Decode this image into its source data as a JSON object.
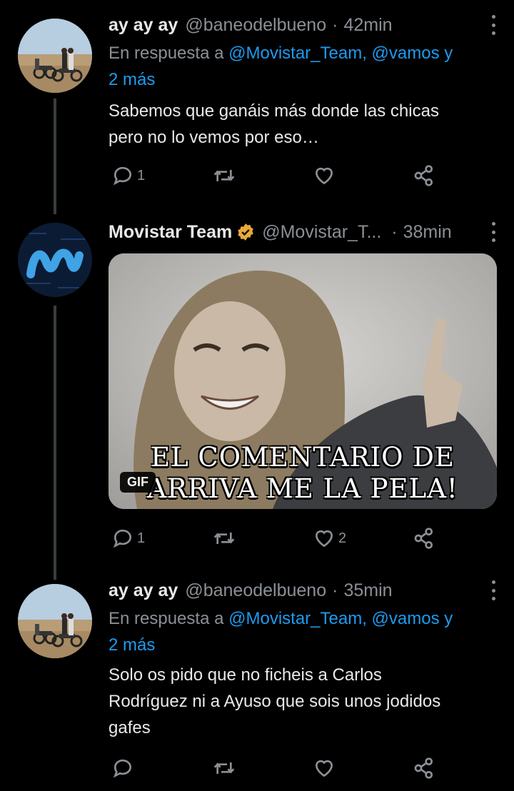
{
  "tweets": [
    {
      "name": "ay ay ay",
      "handle": "@baneodelbueno",
      "time": "42min",
      "reply_prefix": "En respuesta a",
      "reply_mentions": "@Movistar_Team, @vamos y",
      "reply_more": "2 más",
      "text_line1": "Sabemos que ganáis más donde las chicas",
      "text_line2": "pero no lo vemos por eso…",
      "reply_count": "1",
      "retweet_count": "",
      "like_count": ""
    },
    {
      "name": "Movistar Team",
      "handle": "@Movistar_T...",
      "time": "38min",
      "verified": true,
      "media_caption_line1": "EL  COMENTARIO DE",
      "media_caption_line2": "ARRIVA ME LA PELA!",
      "media_badge": "GIF",
      "reply_count": "1",
      "retweet_count": "",
      "like_count": "2"
    },
    {
      "name": "ay ay ay",
      "handle": "@baneodelbueno",
      "time": "35min",
      "reply_prefix": "En respuesta a",
      "reply_mentions": "@Movistar_Team, @vamos y",
      "reply_more": "2 más",
      "text_line1": "Solo os pido que no ficheis a Carlos",
      "text_line2": "Rodríguez ni a Ayuso que sois unos jodidos",
      "text_line3": "gafes",
      "reply_count": "",
      "retweet_count": "",
      "like_count": ""
    }
  ],
  "separator": "·",
  "colors": {
    "background": "#000000",
    "text": "#e7e9ea",
    "muted": "#8b9096",
    "mention": "#1d9bf0",
    "verified_badge": "#e8a93c",
    "movistar_bg": "#0b1b33",
    "movistar_logo": "#3fa3e6"
  },
  "icons": [
    "reply-icon",
    "retweet-icon",
    "like-icon",
    "share-icon",
    "more-icon",
    "verified-icon"
  ]
}
